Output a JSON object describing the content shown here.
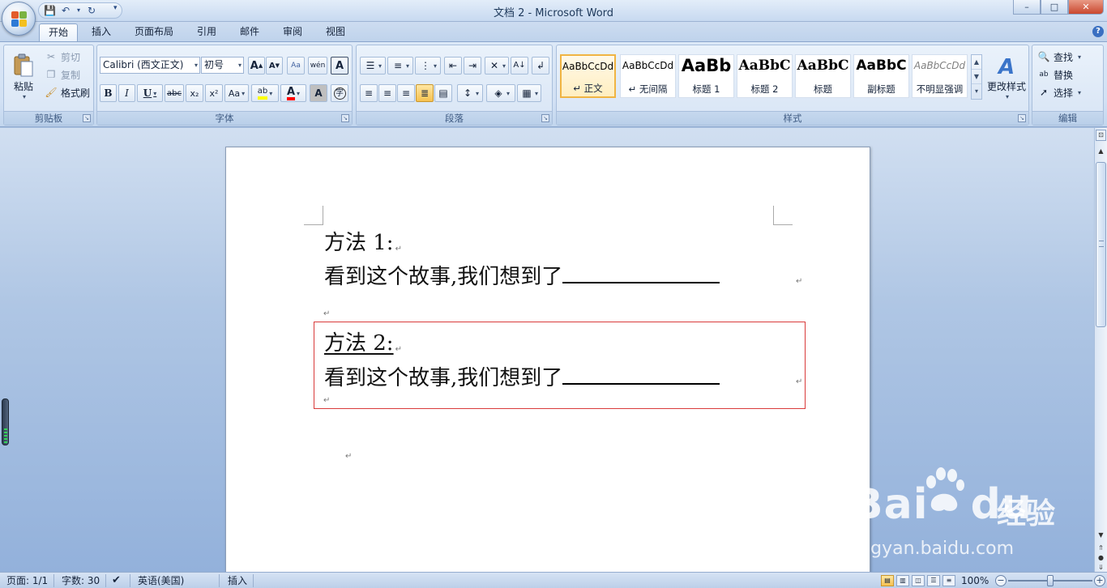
{
  "window": {
    "title": "文档 2 - Microsoft Word",
    "minimize": "–",
    "maximize": "□",
    "close": "✕"
  },
  "qat": {
    "save": "💾",
    "undo": "↶",
    "redo": "↻",
    "more": "▾"
  },
  "tabs": [
    {
      "label": "开始",
      "active": true
    },
    {
      "label": "插入"
    },
    {
      "label": "页面布局"
    },
    {
      "label": "引用"
    },
    {
      "label": "邮件"
    },
    {
      "label": "审阅"
    },
    {
      "label": "视图"
    }
  ],
  "ribbon": {
    "clipboard": {
      "label": "剪贴板",
      "paste": "粘贴",
      "cut": "剪切",
      "copy": "复制",
      "format_painter": "格式刷"
    },
    "font": {
      "label": "字体",
      "font_name": "Calibri (西文正文)",
      "font_size": "初号",
      "grow": "A",
      "shrink": "A",
      "bold": "B",
      "italic": "I",
      "underline": "U",
      "strike": "abc",
      "subscript": "x₂",
      "superscript": "x²",
      "change_case": "Aa",
      "highlight": "ab",
      "font_color": "A",
      "char_shading": "A",
      "enclose": "字",
      "phonetic": "wén",
      "clear": "A"
    },
    "paragraph": {
      "label": "段落"
    },
    "styles": {
      "label": "样式",
      "tiles": [
        {
          "sample": "AaBbCcDd",
          "name": "↵ 正文",
          "selected": true
        },
        {
          "sample": "AaBbCcDd",
          "name": "↵ 无间隔"
        },
        {
          "sample": "AaBb",
          "name": "标题 1"
        },
        {
          "sample": "AaBbC",
          "name": "标题 2"
        },
        {
          "sample": "AaBbC",
          "name": "标题"
        },
        {
          "sample": "AaBbC",
          "name": "副标题"
        },
        {
          "sample": "AaBbCcDd",
          "name": "不明显强调"
        }
      ],
      "change_styles": "更改样式"
    },
    "editing": {
      "label": "编辑",
      "find": "查找",
      "replace": "替换",
      "select": "选择"
    }
  },
  "document": {
    "m1_title": "方法 1:",
    "m1_body": "看到这个故事,我们想到了",
    "m2_title": "方法 2:",
    "m2_body": "看到这个故事,我们想到了",
    "para_mark": "↵"
  },
  "watermark": {
    "brand": "Bai",
    "brand2": "du",
    "cn": "经验",
    "url": "jingyan.baidu.com"
  },
  "status": {
    "page": "页面: 1/1",
    "words": "字数: 30",
    "language": "英语(美国)",
    "mode": "插入",
    "zoom": "100%",
    "zoom_level": 0.5
  },
  "colors": {
    "highlight_yellow": "#ffff00",
    "font_red": "#ff0000",
    "box_red": "#d93b3b"
  }
}
